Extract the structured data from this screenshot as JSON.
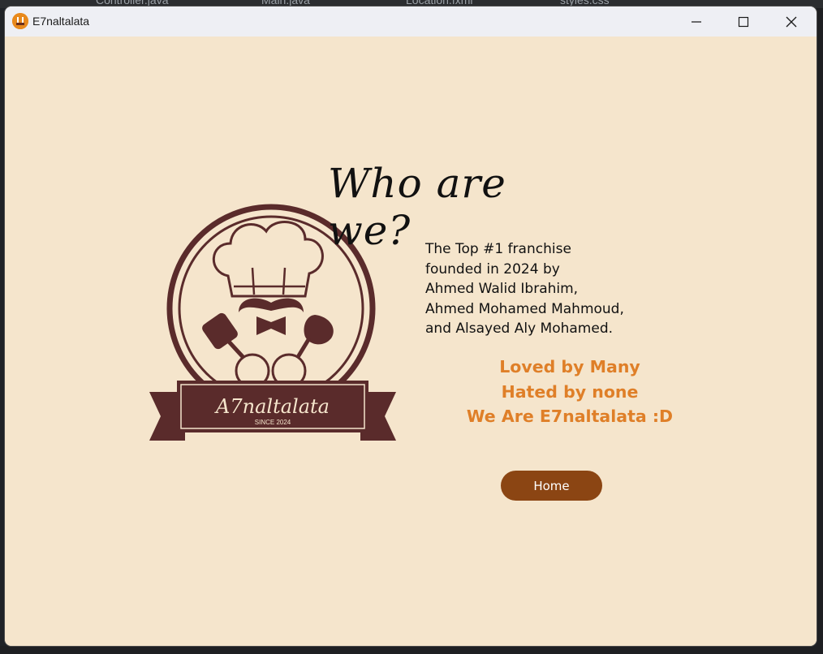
{
  "window": {
    "title": "E7naltalata",
    "controls": [
      "minimize-icon",
      "maximize-icon",
      "close-icon"
    ]
  },
  "background_ide": {
    "tabs": [
      "Controller.java",
      "Main.java",
      "Location.fxml",
      "styles.css"
    ]
  },
  "page": {
    "heading": "Who are we?",
    "description": [
      "The Top #1 franchise",
      "founded in 2024 by",
      "Ahmed Walid Ibrahim,",
      "Ahmed Mohamed Mahmoud,",
      "and Alsayed Aly Mohamed."
    ],
    "tagline": [
      "Loved by Many",
      "Hated by none",
      "We Are E7naltalata :D"
    ],
    "home_button": "Home"
  },
  "logo": {
    "name": "A7naltalata",
    "since": "SINCE 2024"
  },
  "colors": {
    "background": "#f5e5cc",
    "logo_brown": "#5a2b2b",
    "accent_orange": "#df7f28",
    "button": "#8b4513"
  }
}
